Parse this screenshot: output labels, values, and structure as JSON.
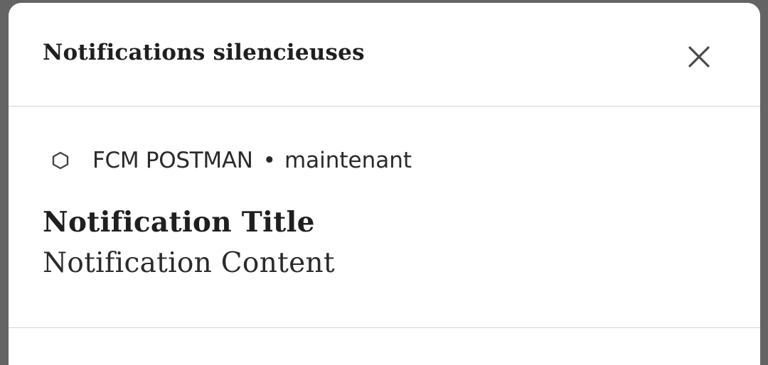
{
  "dialog": {
    "title": "Notifications silencieuses",
    "close_icon": "close-icon"
  },
  "notification": {
    "app_icon": "hexagon-icon",
    "app_name": "FCM POSTMAN",
    "separator": "•",
    "time": "maintenant",
    "title": "Notification Title",
    "content": "Notification Content"
  },
  "colors": {
    "backdrop": "#646464",
    "surface": "#ffffff",
    "divider": "#d6d6d6",
    "text": "#1f1f1f"
  }
}
